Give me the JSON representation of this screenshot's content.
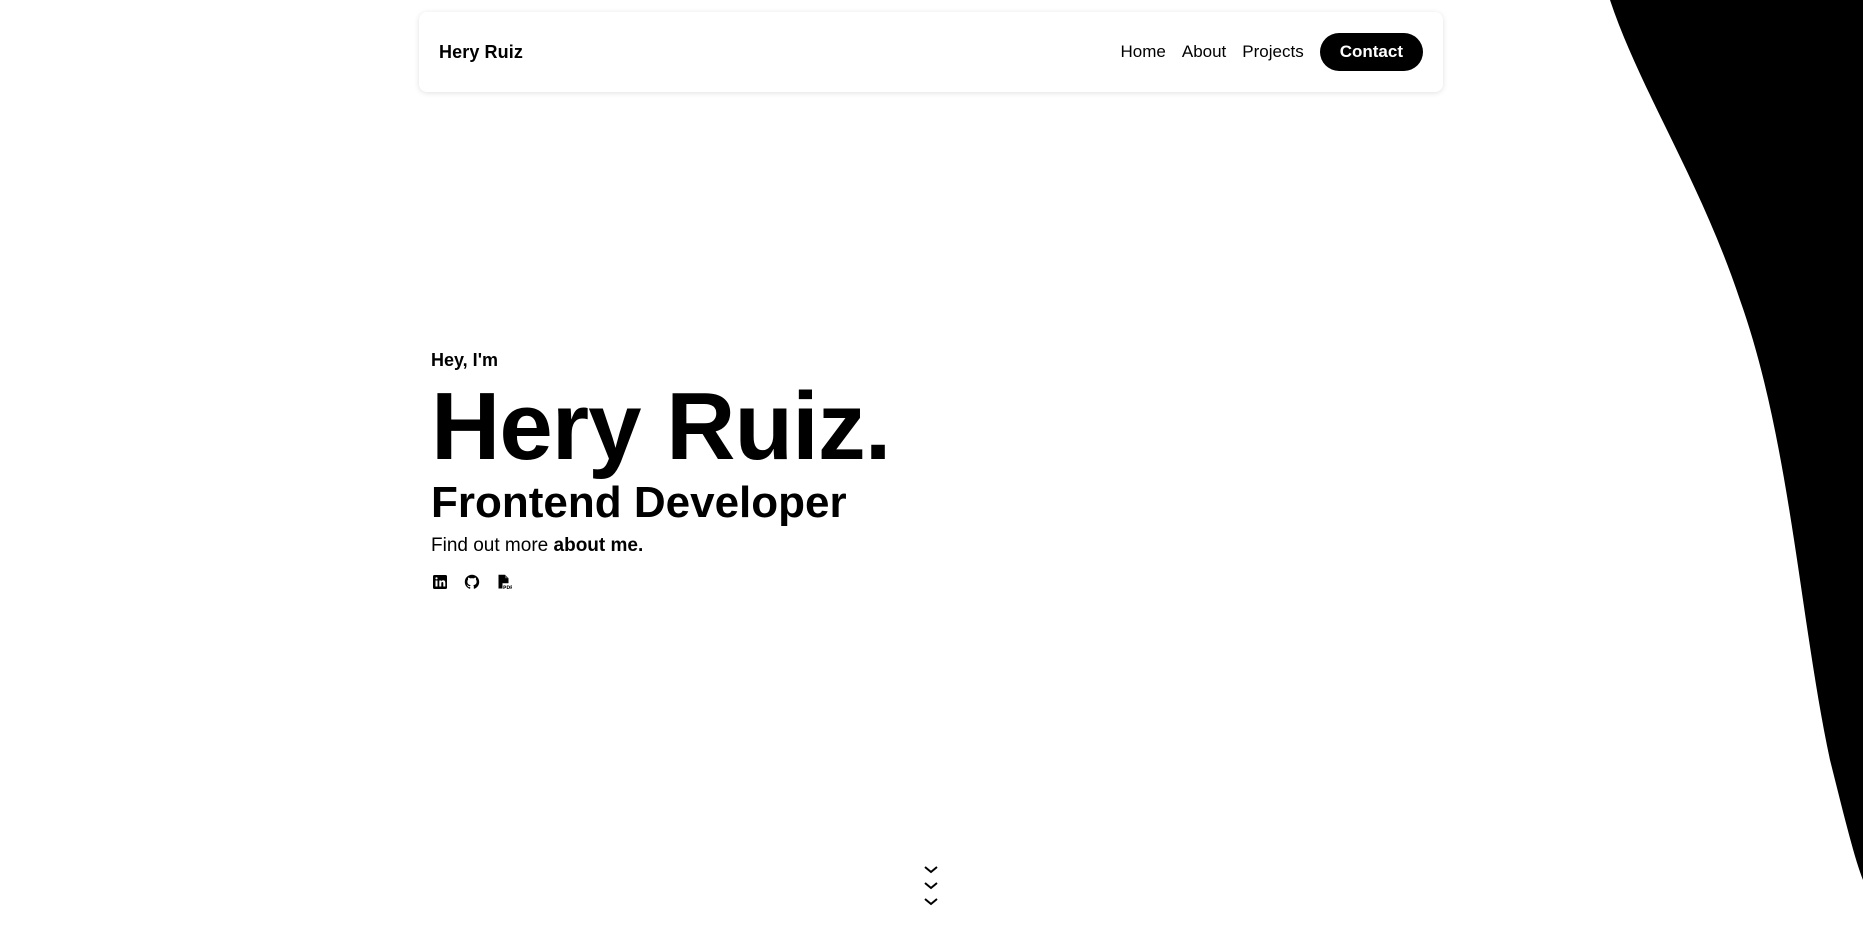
{
  "nav": {
    "brand": "Hery Ruiz",
    "links": [
      "Home",
      "About",
      "Projects"
    ],
    "contact": "Contact"
  },
  "hero": {
    "greeting": "Hey, I'm",
    "name": "Hery Ruiz.",
    "role": "Frontend Developer",
    "more_prefix": "Find out more",
    "more_link": "about me."
  },
  "socials": [
    "linkedin-icon",
    "github-icon",
    "pdf-resume-icon"
  ],
  "scroll_icon": "chevrons-down-icon",
  "colors": {
    "accent": "#000000",
    "background": "#ffffff"
  }
}
